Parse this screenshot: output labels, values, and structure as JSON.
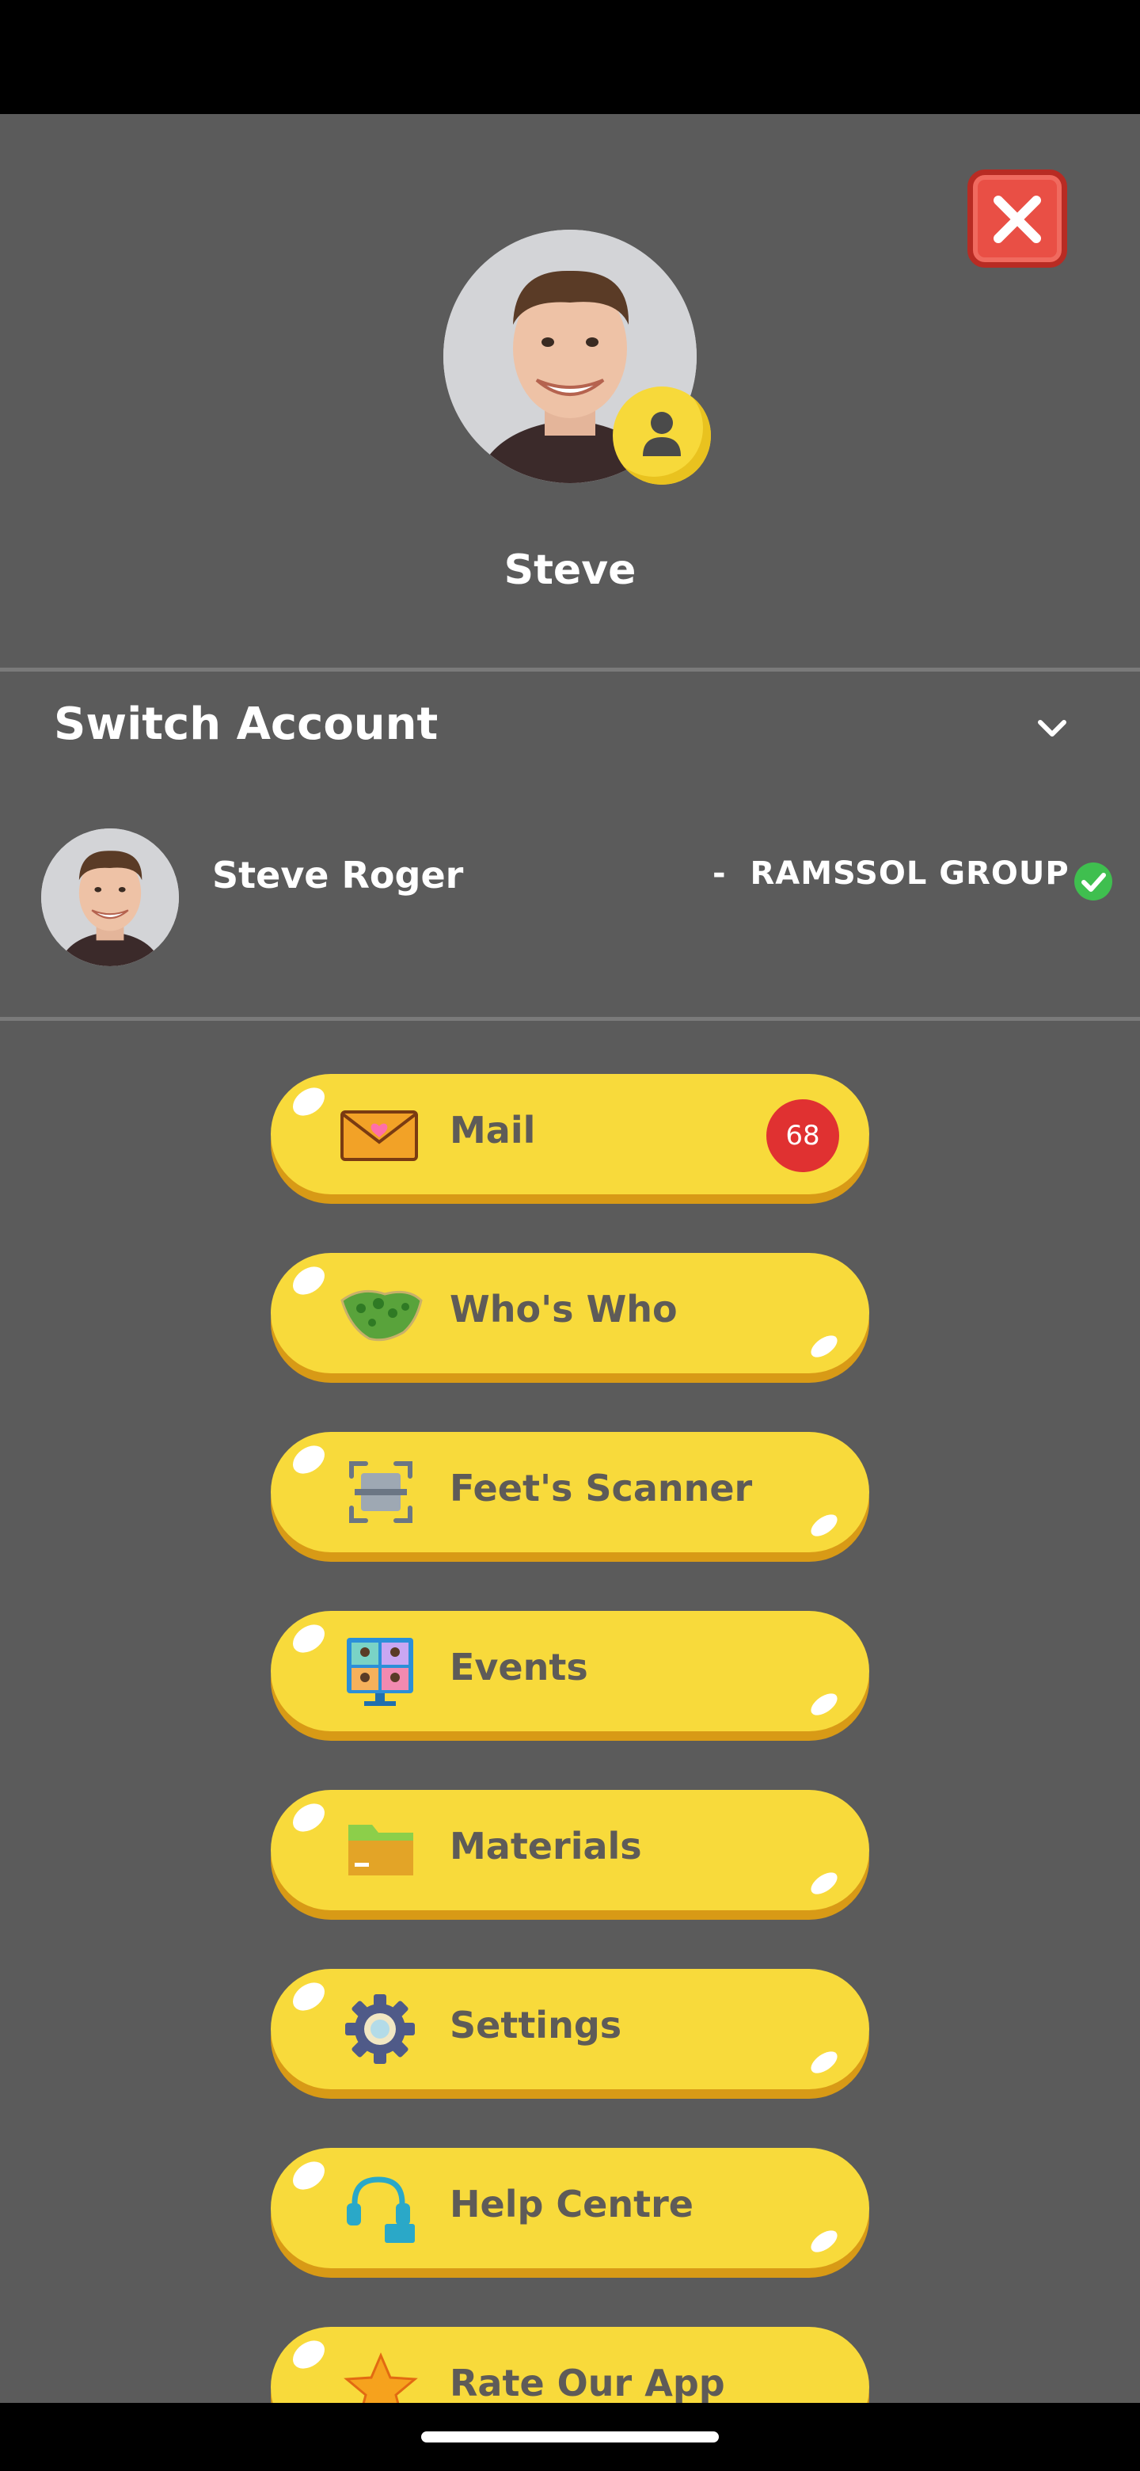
{
  "profile": {
    "name": "Steve"
  },
  "switch_account": {
    "title": "Switch Account",
    "account": {
      "name": "Steve Roger",
      "separator": "-",
      "organization": "RAMSSOL GROUP"
    }
  },
  "menu": [
    {
      "label": "Mail",
      "icon": "mail-icon",
      "badge": "68"
    },
    {
      "label": "Who's Who",
      "icon": "map-icon"
    },
    {
      "label": "Feet's Scanner",
      "icon": "scanner-icon"
    },
    {
      "label": "Events",
      "icon": "video-call-icon"
    },
    {
      "label": "Materials",
      "icon": "folder-icon"
    },
    {
      "label": "Settings",
      "icon": "gear-icon"
    },
    {
      "label": "Help Centre",
      "icon": "headset-icon"
    },
    {
      "label": "Rate Our App",
      "icon": "star-icon"
    }
  ],
  "colors": {
    "background": "#5b5b5b",
    "button": "#f8da3b",
    "button_shadow": "#d89a16",
    "close": "#e94f45",
    "badge": "#e03131",
    "verified": "#3fbf4f"
  }
}
